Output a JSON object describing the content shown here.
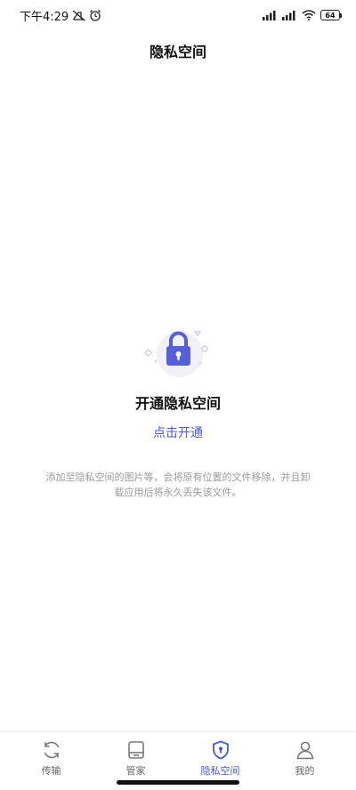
{
  "status_bar": {
    "time": "下午4:29",
    "battery": "64"
  },
  "header": {
    "title": "隐私空间"
  },
  "empty_state": {
    "heading": "开通隐私空间",
    "action_label": "点击开通",
    "notice": "添加至隐私空间的图片等，会将原有位置的文件移除，并且卸载应用后将永久丢失该文件。"
  },
  "tabs": [
    {
      "label": "传输",
      "icon": "refresh-icon",
      "active": false
    },
    {
      "label": "管家",
      "icon": "device-icon",
      "active": false
    },
    {
      "label": "隐私空间",
      "icon": "shield-icon",
      "active": true
    },
    {
      "label": "我的",
      "icon": "person-icon",
      "active": false
    }
  ],
  "colors": {
    "accent": "#4b57d6",
    "muted_text": "#9a9a9a"
  }
}
